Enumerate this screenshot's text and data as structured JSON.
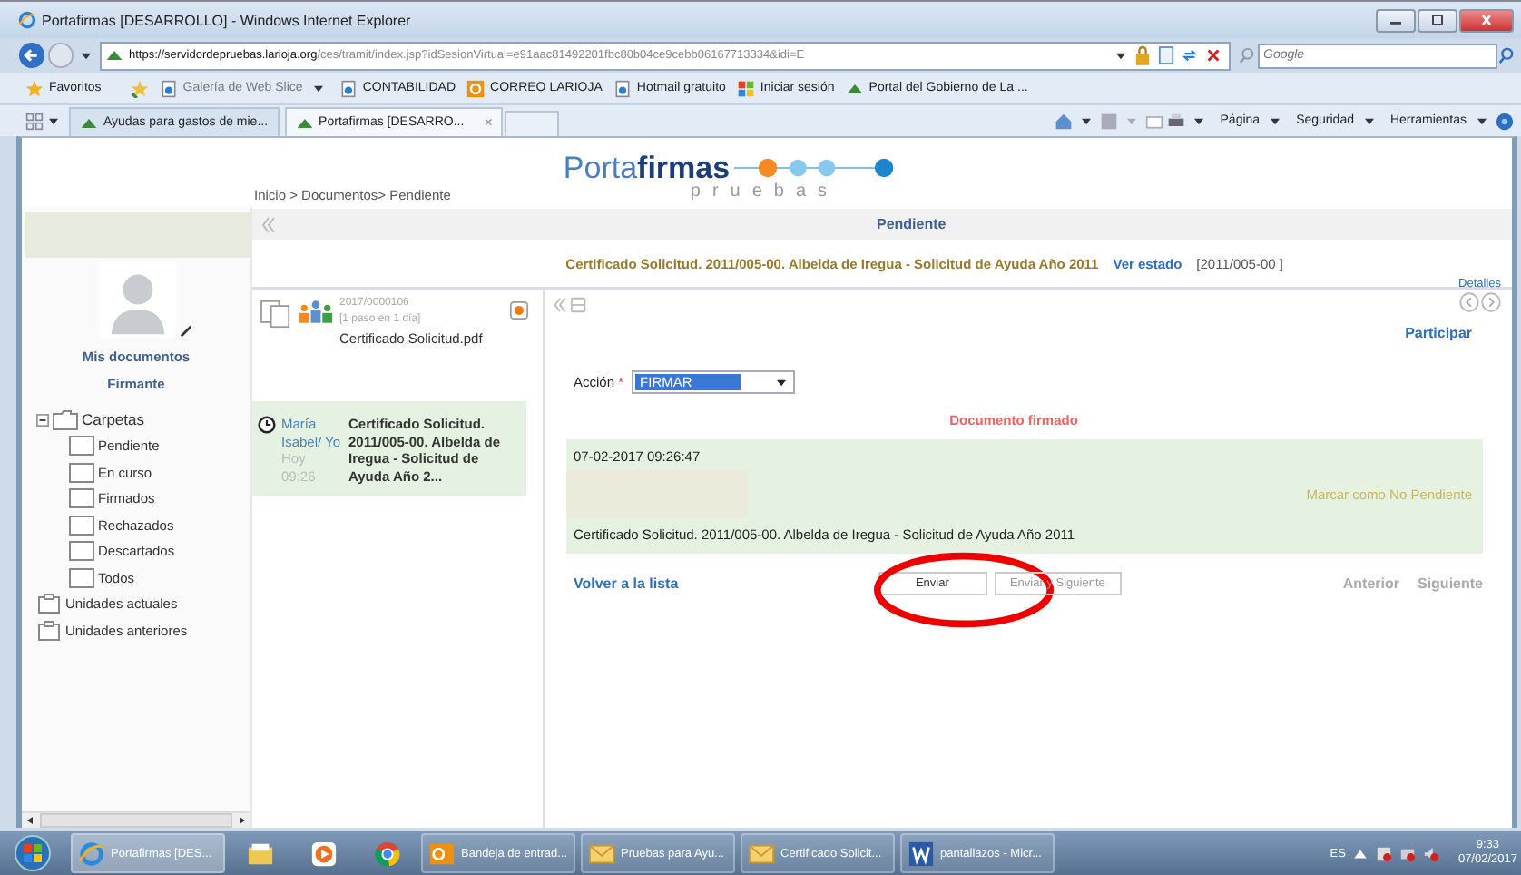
{
  "browser": {
    "title": "Portafirmas [DESARROLLO] - Windows Internet Explorer",
    "url_host": "https://servidordepruebas.larioja.org",
    "url_path": "/ces/tramit/index.jsp?idSesionVirtual=e91aac81492201fbc80b04ce9cebb06167713334&idi=E",
    "search_placeholder": "Google",
    "favorites_label": "Favoritos",
    "favorites": [
      {
        "label": "Galería de Web Slice",
        "kind": "page",
        "dropdown": true
      },
      {
        "label": "CONTABILIDAD",
        "kind": "page",
        "dropdown": false
      },
      {
        "label": "CORREO LARIOJA",
        "kind": "outlook",
        "dropdown": false
      },
      {
        "label": "Hotmail gratuito",
        "kind": "page",
        "dropdown": false
      },
      {
        "label": "Iniciar sesión",
        "kind": "windows",
        "dropdown": false
      },
      {
        "label": "Portal del Gobierno de La ...",
        "kind": "site",
        "dropdown": false
      }
    ],
    "tabs": [
      {
        "label": "Ayudas para gastos de mie...",
        "selected": false
      },
      {
        "label": "Portafirmas [DESARRO...",
        "selected": true
      }
    ],
    "tab_close": "×",
    "command_menus": [
      "Página",
      "Seguridad",
      "Herramientas"
    ]
  },
  "page": {
    "logo": {
      "first": "Porta",
      "second": "firmas",
      "subtitle": "pruebas"
    },
    "breadcrumb": "Inicio > Documentos> Pendiente",
    "section_title": "Pendiente",
    "document_title": "Certificado Solicitud. 2011/005-00. Albelda de Iregua - Solicitud de Ayuda Año 2011",
    "status_link": "Ver estado",
    "reference": "[2011/005-00 ]",
    "sidebar": {
      "heading": "Mis documentos",
      "role": "Firmante",
      "tree": [
        {
          "label": "Carpetas",
          "kind": "folder",
          "expanded": true,
          "children": [
            {
              "label": "Pendiente",
              "kind": "folder"
            },
            {
              "label": "En curso",
              "kind": "folder"
            },
            {
              "label": "Firmados",
              "kind": "folder"
            },
            {
              "label": "Rechazados",
              "kind": "folder"
            },
            {
              "label": "Descartados",
              "kind": "folder"
            },
            {
              "label": "Todos",
              "kind": "folder"
            }
          ]
        },
        {
          "label": "Unidades actuales",
          "kind": "unit"
        },
        {
          "label": "Unidades anteriores",
          "kind": "unit"
        }
      ]
    },
    "document_card": {
      "number": "2017/0000106",
      "steps": "[1 paso en 1 día]",
      "file": "Certificado Solicitud.pdf"
    },
    "messages": [
      {
        "author": "María Isabel/ Yo",
        "day": "Hoy",
        "time": "09:26",
        "title": "Certificado Solicitud. 2011/005-00. Albelda de Iregua - Solicitud de Ayuda Año 2...",
        "selected": true
      }
    ],
    "details_link": "Detalles",
    "participate_link": "Participar",
    "action_label": "Acción",
    "action_required": "*",
    "action_value": "FIRMAR",
    "status_message": "Documento firmado",
    "history": {
      "timestamp": "07-02-2017 09:26:47",
      "mark_link": "Marcar como No Pendiente",
      "description": "Certificado Solicitud. 2011/005-00. Albelda de Iregua - Solicitud de Ayuda Año 2011"
    },
    "back_link": "Volver a la lista",
    "buttons": [
      {
        "label": "Enviar",
        "disabled": false
      },
      {
        "label": "Enviar y Siguiente",
        "disabled": true
      }
    ],
    "nav": [
      {
        "label": "Anterior",
        "disabled": true
      },
      {
        "label": "Siguiente",
        "disabled": true
      }
    ]
  },
  "taskbar": {
    "items": [
      {
        "kind": "ie",
        "label": "Portafirmas [DES...",
        "selected": true
      },
      {
        "kind": "explorer",
        "selected": false
      },
      {
        "kind": "media",
        "selected": false
      },
      {
        "kind": "chrome",
        "selected": false
      },
      {
        "kind": "outlook",
        "label": "Bandeja de entrad...",
        "selected": false
      },
      {
        "kind": "mail",
        "label": "Pruebas para Ayu...",
        "selected": false
      },
      {
        "kind": "mail",
        "label": "Certificado Solicit...",
        "selected": false
      },
      {
        "kind": "word",
        "label": "pantallazos - Micr...",
        "selected": false
      }
    ],
    "language": "ES",
    "time": "9:33",
    "date": "07/02/2017"
  }
}
